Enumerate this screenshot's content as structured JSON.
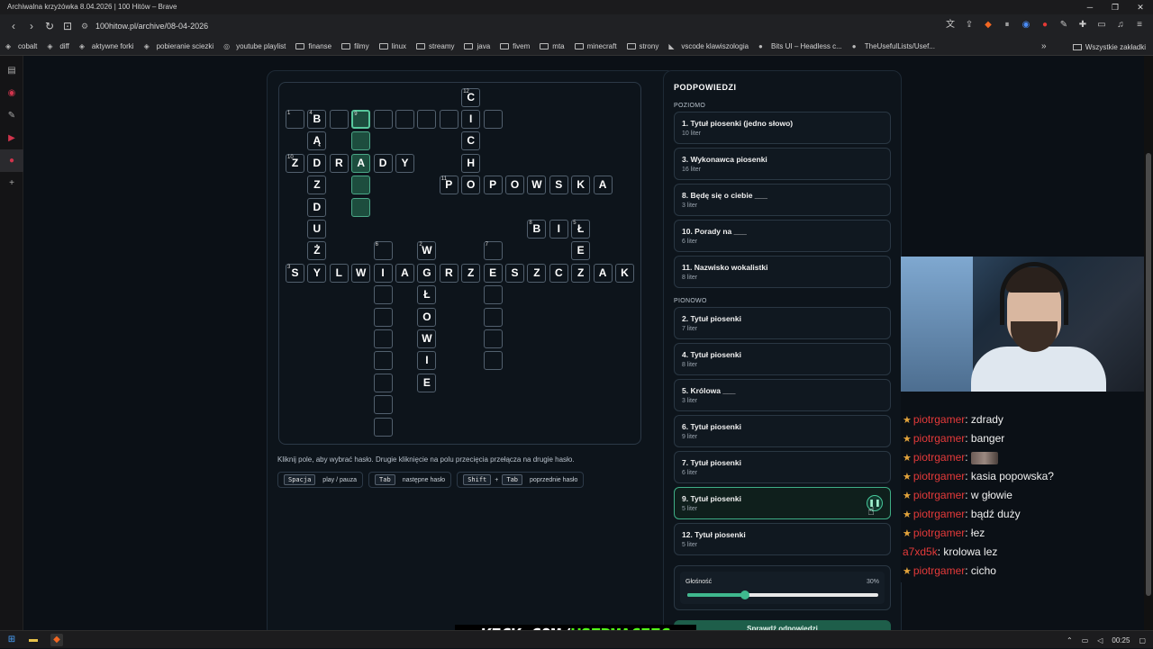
{
  "window": {
    "title": "Archiwalna krzyżówka 8.04.2026 | 100 Hitów – Brave"
  },
  "url": "100hitow.pl/archive/08-04-2026",
  "bookmarks": [
    {
      "label": "cobalt",
      "icon": "cobalt-icon"
    },
    {
      "label": "diff",
      "icon": "diff-icon"
    },
    {
      "label": "aktywne forki",
      "icon": "fork-icon"
    },
    {
      "label": "pobieranie sciezki",
      "icon": "download-icon"
    },
    {
      "label": "youtube playlist",
      "icon": "globe-icon"
    },
    {
      "label": "finanse",
      "icon": "folder-icon"
    },
    {
      "label": "filmy",
      "icon": "folder-icon"
    },
    {
      "label": "linux",
      "icon": "folder-icon"
    },
    {
      "label": "streamy",
      "icon": "folder-icon"
    },
    {
      "label": "java",
      "icon": "folder-icon"
    },
    {
      "label": "fivem",
      "icon": "folder-icon"
    },
    {
      "label": "mta",
      "icon": "folder-icon"
    },
    {
      "label": "minecraft",
      "icon": "folder-icon"
    },
    {
      "label": "strony",
      "icon": "folder-icon"
    },
    {
      "label": "vscode klawiszologia",
      "icon": "vscode-icon"
    },
    {
      "label": "Bits UI – Headless c...",
      "icon": "circle-icon"
    },
    {
      "label": "TheUsefulLists/Usef...",
      "icon": "github-icon"
    }
  ],
  "bookmarks_all": "Wszystkie zakładki",
  "grid": {
    "cells": [
      {
        "r": -1,
        "c": 8,
        "letter": "C",
        "num": "12"
      },
      {
        "r": 0,
        "c": 0,
        "letter": "",
        "num": "1"
      },
      {
        "r": 0,
        "c": 1,
        "letter": "B",
        "num": "4"
      },
      {
        "r": 0,
        "c": 2,
        "letter": ""
      },
      {
        "r": 0,
        "c": 3,
        "letter": "",
        "num": "9",
        "state": "act"
      },
      {
        "r": 0,
        "c": 4,
        "letter": ""
      },
      {
        "r": 0,
        "c": 5,
        "letter": ""
      },
      {
        "r": 0,
        "c": 6,
        "letter": ""
      },
      {
        "r": 0,
        "c": 7,
        "letter": ""
      },
      {
        "r": 0,
        "c": 8,
        "letter": "I"
      },
      {
        "r": 0,
        "c": 9,
        "letter": ""
      },
      {
        "r": 1,
        "c": 1,
        "letter": "Ą"
      },
      {
        "r": 1,
        "c": 3,
        "letter": "",
        "state": "hl"
      },
      {
        "r": 1,
        "c": 8,
        "letter": "C"
      },
      {
        "r": 2,
        "c": 0,
        "letter": "Z",
        "num": "10"
      },
      {
        "r": 2,
        "c": 1,
        "letter": "D"
      },
      {
        "r": 2,
        "c": 2,
        "letter": "R"
      },
      {
        "r": 2,
        "c": 3,
        "letter": "A",
        "state": "hl"
      },
      {
        "r": 2,
        "c": 4,
        "letter": "D"
      },
      {
        "r": 2,
        "c": 5,
        "letter": "Y"
      },
      {
        "r": 2,
        "c": 8,
        "letter": "H"
      },
      {
        "r": 3,
        "c": 1,
        "letter": "Z"
      },
      {
        "r": 3,
        "c": 3,
        "letter": "",
        "state": "hl"
      },
      {
        "r": 3,
        "c": 7,
        "letter": "P",
        "num": "11"
      },
      {
        "r": 3,
        "c": 8,
        "letter": "O"
      },
      {
        "r": 3,
        "c": 9,
        "letter": "P"
      },
      {
        "r": 3,
        "c": 10,
        "letter": "O"
      },
      {
        "r": 3,
        "c": 11,
        "letter": "W"
      },
      {
        "r": 3,
        "c": 12,
        "letter": "S"
      },
      {
        "r": 3,
        "c": 13,
        "letter": "K"
      },
      {
        "r": 3,
        "c": 14,
        "letter": "A"
      },
      {
        "r": 4,
        "c": 1,
        "letter": "D"
      },
      {
        "r": 4,
        "c": 3,
        "letter": "",
        "state": "hl"
      },
      {
        "r": 5,
        "c": 1,
        "letter": "U"
      },
      {
        "r": 5,
        "c": 11,
        "letter": "B",
        "num": "8"
      },
      {
        "r": 5,
        "c": 12,
        "letter": "I"
      },
      {
        "r": 5,
        "c": 13,
        "letter": "Ł",
        "num": "5"
      },
      {
        "r": 6,
        "c": 1,
        "letter": "Ż"
      },
      {
        "r": 6,
        "c": 4,
        "letter": "",
        "num": "6"
      },
      {
        "r": 6,
        "c": 6,
        "letter": "W",
        "num": "2"
      },
      {
        "r": 6,
        "c": 9,
        "letter": "",
        "num": "7"
      },
      {
        "r": 6,
        "c": 13,
        "letter": "E"
      },
      {
        "r": 7,
        "c": 0,
        "letter": "S",
        "num": "3"
      },
      {
        "r": 7,
        "c": 1,
        "letter": "Y"
      },
      {
        "r": 7,
        "c": 2,
        "letter": "L"
      },
      {
        "r": 7,
        "c": 3,
        "letter": "W"
      },
      {
        "r": 7,
        "c": 4,
        "letter": "I"
      },
      {
        "r": 7,
        "c": 5,
        "letter": "A"
      },
      {
        "r": 7,
        "c": 6,
        "letter": "G"
      },
      {
        "r": 7,
        "c": 7,
        "letter": "R"
      },
      {
        "r": 7,
        "c": 8,
        "letter": "Z"
      },
      {
        "r": 7,
        "c": 9,
        "letter": "E"
      },
      {
        "r": 7,
        "c": 10,
        "letter": "S"
      },
      {
        "r": 7,
        "c": 11,
        "letter": "Z"
      },
      {
        "r": 7,
        "c": 12,
        "letter": "C"
      },
      {
        "r": 7,
        "c": 13,
        "letter": "Z"
      },
      {
        "r": 7,
        "c": 14,
        "letter": "A"
      },
      {
        "r": 7,
        "c": 15,
        "letter": "K"
      },
      {
        "r": 8,
        "c": 4,
        "letter": ""
      },
      {
        "r": 8,
        "c": 6,
        "letter": "Ł"
      },
      {
        "r": 8,
        "c": 9,
        "letter": ""
      },
      {
        "r": 9,
        "c": 4,
        "letter": ""
      },
      {
        "r": 9,
        "c": 6,
        "letter": "O"
      },
      {
        "r": 9,
        "c": 9,
        "letter": ""
      },
      {
        "r": 10,
        "c": 4,
        "letter": ""
      },
      {
        "r": 10,
        "c": 6,
        "letter": "W"
      },
      {
        "r": 10,
        "c": 9,
        "letter": ""
      },
      {
        "r": 11,
        "c": 4,
        "letter": ""
      },
      {
        "r": 11,
        "c": 6,
        "letter": "I"
      },
      {
        "r": 11,
        "c": 9,
        "letter": ""
      },
      {
        "r": 12,
        "c": 4,
        "letter": ""
      },
      {
        "r": 12,
        "c": 6,
        "letter": "E"
      },
      {
        "r": 13,
        "c": 4,
        "letter": ""
      },
      {
        "r": 14,
        "c": 4,
        "letter": ""
      }
    ]
  },
  "help": {
    "hint": "Kliknij pole, aby wybrać hasło. Drugie kliknięcie na polu przecięcia przełącza na drugie hasło.",
    "keys": [
      {
        "keys": [
          "Spacja"
        ],
        "label": "play / pauza"
      },
      {
        "keys": [
          "Tab"
        ],
        "label": "następne hasło"
      },
      {
        "keys": [
          "Shift",
          "Tab"
        ],
        "label": "poprzednie hasło"
      }
    ]
  },
  "clues": {
    "title": "PODPOWIEDZI",
    "across_label": "POZIOMO",
    "down_label": "PIONOWO",
    "across": [
      {
        "title": "1. Tytuł piosenki (jedno słowo)",
        "sub": "10 liter"
      },
      {
        "title": "3. Wykonawca piosenki",
        "sub": "16 liter"
      },
      {
        "title": "8. Będę się o ciebie ___",
        "sub": "3 liter"
      },
      {
        "title": "10. Porady na ___",
        "sub": "6 liter"
      },
      {
        "title": "11. Nazwisko wokalistki",
        "sub": "8 liter"
      }
    ],
    "down": [
      {
        "title": "2. Tytuł piosenki",
        "sub": "7 liter"
      },
      {
        "title": "4. Tytuł piosenki",
        "sub": "8 liter"
      },
      {
        "title": "5. Królowa ___",
        "sub": "3 liter"
      },
      {
        "title": "6. Tytuł piosenki",
        "sub": "9 liter"
      },
      {
        "title": "7. Tytuł piosenki",
        "sub": "6 liter"
      },
      {
        "title": "9. Tytuł piosenki",
        "sub": "5 liter",
        "active": true
      },
      {
        "title": "12. Tytuł piosenki",
        "sub": "5 liter"
      }
    ]
  },
  "volume": {
    "label": "Głośność",
    "value_text": "30%",
    "value": 0.3
  },
  "check_button": "Sprawdź odpowiedzi",
  "chat": [
    {
      "user": "piotrgamer",
      "text": "zdrady"
    },
    {
      "user": "piotrgamer",
      "text": "banger"
    },
    {
      "user": "piotrgamer",
      "text": "",
      "emote": true
    },
    {
      "user": "piotrgamer",
      "text": "kasia popowska?"
    },
    {
      "user": "piotrgamer",
      "text": "w głowie"
    },
    {
      "user": "piotrgamer",
      "text": "bądź duży"
    },
    {
      "user": "piotrgamer",
      "text": "łez"
    },
    {
      "user": "a7xd5k",
      "text": "krolowa lez",
      "nostar": true
    },
    {
      "user": "piotrgamer",
      "text": "cicho"
    }
  ],
  "banner": {
    "part1": "KICK.COM/",
    "part2": "USERMACIEG"
  },
  "taskbar": {
    "time": "00:25"
  },
  "colors": {
    "accent": "#3fb88e",
    "chat_user": "#e53a3a",
    "kick_green": "#53fc18"
  }
}
